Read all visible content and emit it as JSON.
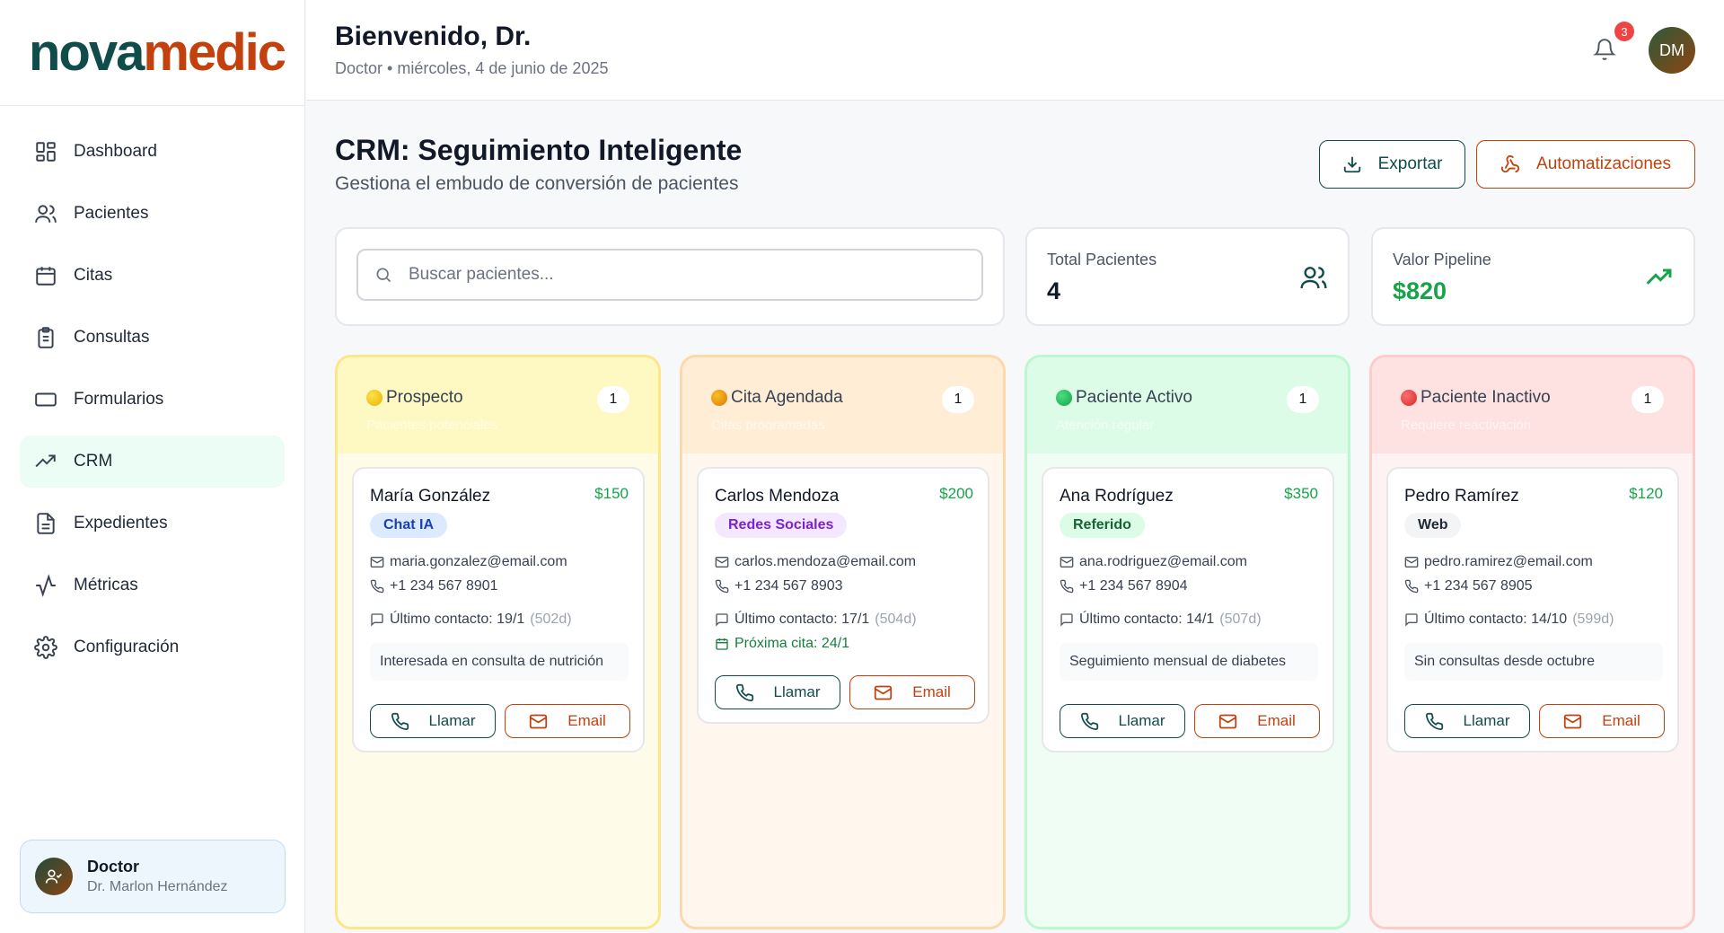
{
  "brand": {
    "part1": "nova",
    "part2": "medic"
  },
  "sidebar": {
    "items": [
      {
        "label": "Dashboard",
        "icon": "layout-grid-icon"
      },
      {
        "label": "Pacientes",
        "icon": "users-icon"
      },
      {
        "label": "Citas",
        "icon": "calendar-icon"
      },
      {
        "label": "Consultas",
        "icon": "clipboard-icon"
      },
      {
        "label": "Formularios",
        "icon": "form-icon"
      },
      {
        "label": "CRM",
        "icon": "trending-up-icon",
        "active": true
      },
      {
        "label": "Expedientes",
        "icon": "file-text-icon"
      },
      {
        "label": "Métricas",
        "icon": "activity-icon"
      },
      {
        "label": "Configuración",
        "icon": "gear-icon"
      }
    ]
  },
  "user": {
    "role": "Doctor",
    "name": "Dr. Marlon Hernández"
  },
  "header": {
    "title": "Bienvenido, Dr.",
    "subtitle": "Doctor • miércoles, 4 de junio de 2025",
    "notifications": "3",
    "avatar_initials": "DM"
  },
  "page": {
    "title": "CRM: Seguimiento Inteligente",
    "subtitle": "Gestiona el embudo de conversión de pacientes",
    "export_label": "Exportar",
    "automations_label": "Automatizaciones"
  },
  "search": {
    "placeholder": "Buscar pacientes..."
  },
  "stats": {
    "total_label": "Total Pacientes",
    "total_value": "4",
    "pipeline_label": "Valor Pipeline",
    "pipeline_value": "$820"
  },
  "columns": [
    {
      "name": "Prospecto",
      "desc": "Pacientes potenciales",
      "count": "1",
      "color": "#facc15",
      "card": {
        "name": "María González",
        "value": "$150",
        "tag": "Chat IA",
        "email": "maria.gonzalez@email.com",
        "phone": "+1 234 567 8901",
        "last": "Último contacto: 19/1",
        "days": "(502d)",
        "note": "Interesada en consulta de nutrición",
        "call": "Llamar",
        "mail": "Email"
      }
    },
    {
      "name": "Cita Agendada",
      "desc": "Citas programadas",
      "count": "1",
      "color": "#f59e0b",
      "card": {
        "name": "Carlos Mendoza",
        "value": "$200",
        "tag": "Redes Sociales",
        "email": "carlos.mendoza@email.com",
        "phone": "+1 234 567 8903",
        "last": "Último contacto: 17/1",
        "days": "(504d)",
        "next": "Próxima cita: 24/1",
        "call": "Llamar",
        "mail": "Email"
      }
    },
    {
      "name": "Paciente Activo",
      "desc": "Atención regular",
      "count": "1",
      "color": "#22c55e",
      "card": {
        "name": "Ana Rodríguez",
        "value": "$350",
        "tag": "Referido",
        "email": "ana.rodriguez@email.com",
        "phone": "+1 234 567 8904",
        "last": "Último contacto: 14/1",
        "days": "(507d)",
        "note": "Seguimiento mensual de diabetes",
        "call": "Llamar",
        "mail": "Email"
      }
    },
    {
      "name": "Paciente Inactivo",
      "desc": "Requiere reactivación",
      "count": "1",
      "color": "#ef4444",
      "card": {
        "name": "Pedro Ramírez",
        "value": "$120",
        "tag": "Web",
        "email": "pedro.ramirez@email.com",
        "phone": "+1 234 567 8905",
        "last": "Último contacto: 14/10",
        "days": "(599d)",
        "note": "Sin consultas desde octubre",
        "call": "Llamar",
        "mail": "Email"
      }
    }
  ]
}
